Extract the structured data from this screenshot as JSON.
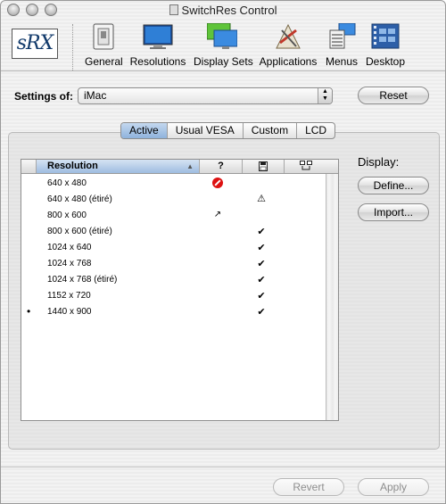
{
  "window": {
    "title": "SwitchRes Control"
  },
  "toolbar": {
    "logo_text": "sRX",
    "items": [
      {
        "label": "General",
        "icon": "switch-panel-icon"
      },
      {
        "label": "Resolutions",
        "icon": "monitor-icon"
      },
      {
        "label": "Display Sets",
        "icon": "multi-monitor-icon"
      },
      {
        "label": "Applications",
        "icon": "applications-icon"
      },
      {
        "label": "Menus",
        "icon": "menu-list-icon"
      },
      {
        "label": "Desktop",
        "icon": "desktop-film-icon"
      }
    ]
  },
  "settings": {
    "label": "Settings of:",
    "selected": "iMac",
    "reset_label": "Reset"
  },
  "tabs": [
    {
      "label": "Active",
      "active": true
    },
    {
      "label": "Usual VESA",
      "active": false
    },
    {
      "label": "Custom",
      "active": false
    },
    {
      "label": "LCD",
      "active": false
    }
  ],
  "table": {
    "columns": {
      "resolution": "Resolution",
      "question": "?"
    },
    "rows": [
      {
        "bullet": "",
        "resolution": "640 x 480",
        "status": "stop",
        "check": ""
      },
      {
        "bullet": "",
        "resolution": "640 x 480 (étiré)",
        "status": "",
        "check": "⚠"
      },
      {
        "bullet": "",
        "resolution": "800 x 600",
        "status": "↗",
        "check": ""
      },
      {
        "bullet": "",
        "resolution": "800 x 600 (étiré)",
        "status": "",
        "check": "✔"
      },
      {
        "bullet": "",
        "resolution": "1024 x 640",
        "status": "",
        "check": "✔"
      },
      {
        "bullet": "",
        "resolution": "1024 x 768",
        "status": "",
        "check": "✔"
      },
      {
        "bullet": "",
        "resolution": "1024 x 768 (étiré)",
        "status": "",
        "check": "✔"
      },
      {
        "bullet": "",
        "resolution": "1152 x 720",
        "status": "",
        "check": "✔"
      },
      {
        "bullet": "•",
        "resolution": "1440 x 900",
        "status": "",
        "check": "✔"
      }
    ]
  },
  "display_panel": {
    "label": "Display:",
    "define_label": "Define...",
    "import_label": "Import..."
  },
  "footer": {
    "revert_label": "Revert",
    "apply_label": "Apply"
  }
}
